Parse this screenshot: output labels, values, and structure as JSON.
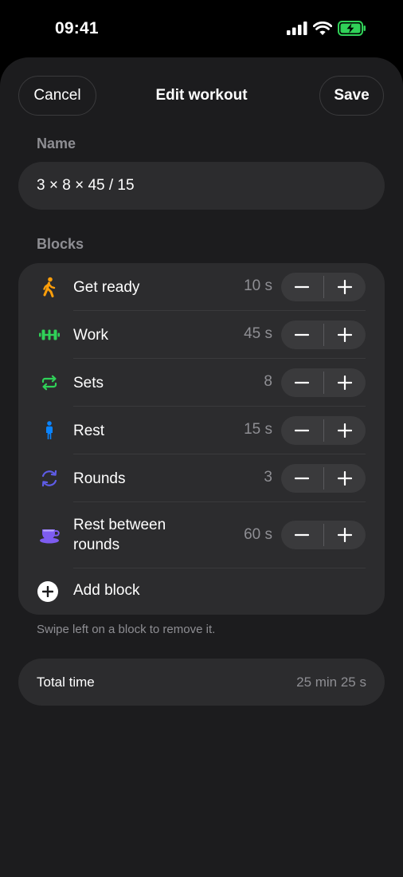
{
  "status_bar": {
    "time": "09:41"
  },
  "header": {
    "cancel_label": "Cancel",
    "title": "Edit workout",
    "save_label": "Save"
  },
  "name_section": {
    "label": "Name",
    "value": "3 × 8 × 45 / 15"
  },
  "blocks_section": {
    "label": "Blocks",
    "items": [
      {
        "label": "Get ready",
        "value": "10 s",
        "icon": "person-walking-icon",
        "color": "#ff9f0a"
      },
      {
        "label": "Work",
        "value": "45 s",
        "icon": "dumbbell-icon",
        "color": "#30d158"
      },
      {
        "label": "Sets",
        "value": "8",
        "icon": "repeat-icon",
        "color": "#30d158"
      },
      {
        "label": "Rest",
        "value": "15 s",
        "icon": "person-standing-icon",
        "color": "#0a84ff"
      },
      {
        "label": "Rounds",
        "value": "3",
        "icon": "rotate-icon",
        "color": "#5e5ce6"
      },
      {
        "label": "Rest between\nrounds",
        "value": "60 s",
        "icon": "cup-icon",
        "color": "#7d5cf0"
      }
    ],
    "add_label": "Add block",
    "decrement_symbol": "−",
    "increment_symbol": "+"
  },
  "hint": "Swipe left on a block to remove it.",
  "total": {
    "label": "Total time",
    "value": "25 min 25 s"
  }
}
